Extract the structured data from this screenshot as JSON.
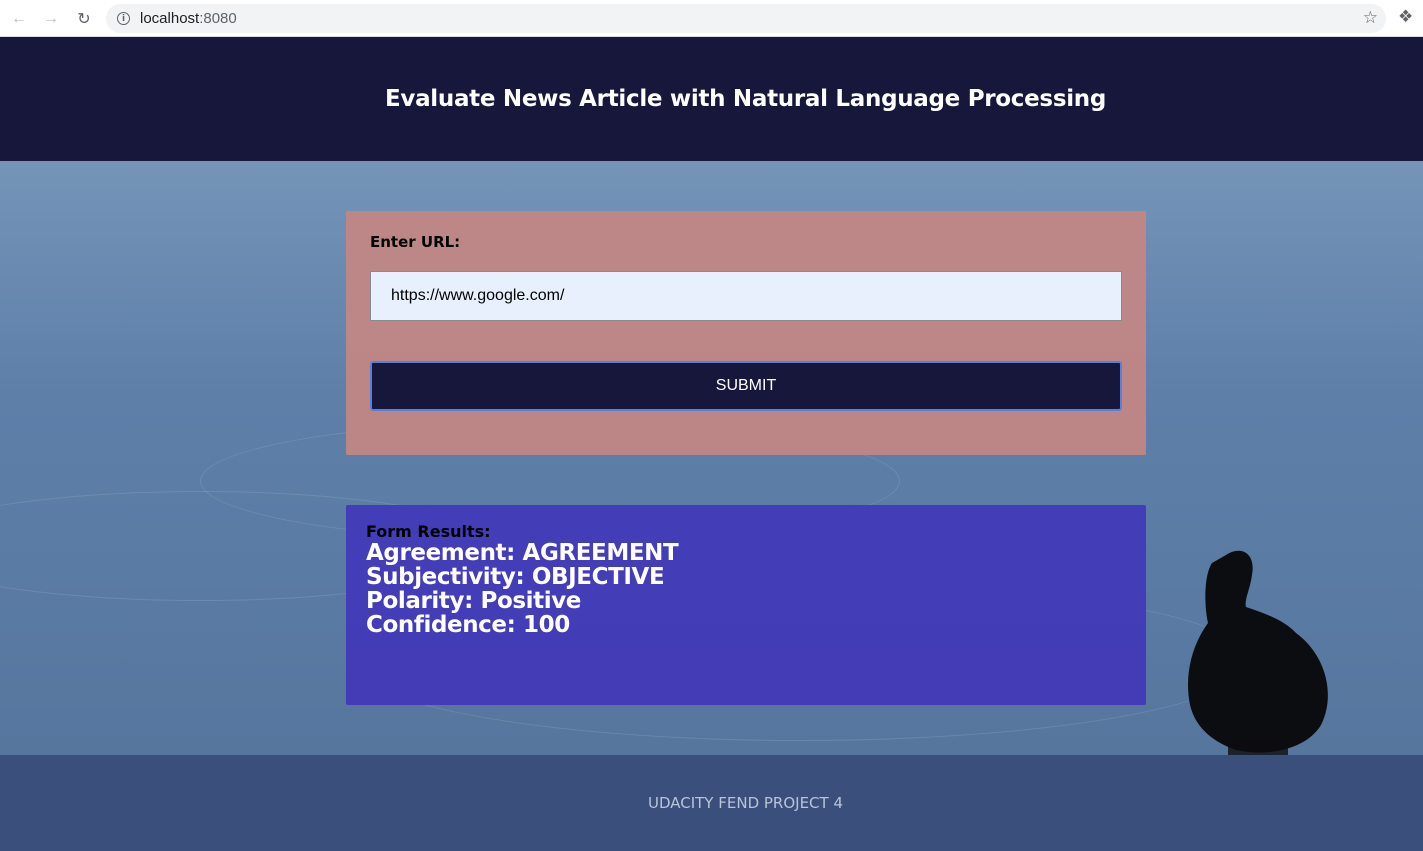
{
  "browser": {
    "url_host": "localhost",
    "url_port": ":8080"
  },
  "header": {
    "title": "Evaluate News Article with Natural Language Processing"
  },
  "form": {
    "label": "Enter URL:",
    "input_value": "https://www.google.com/",
    "submit_label": "SUBMIT"
  },
  "results": {
    "title": "Form Results:",
    "agreement": "Agreement: AGREEMENT",
    "subjectivity": "Subjectivity: OBJECTIVE",
    "polarity": "Polarity: Positive",
    "confidence": "Confidence: 100"
  },
  "footer": {
    "text": "UDACITY FEND PROJECT 4"
  },
  "colors": {
    "header_bg": "#16173b",
    "form_card_bg": "#c48783",
    "results_card_bg": "#4238b8",
    "footer_bg": "#3a4f7c"
  }
}
